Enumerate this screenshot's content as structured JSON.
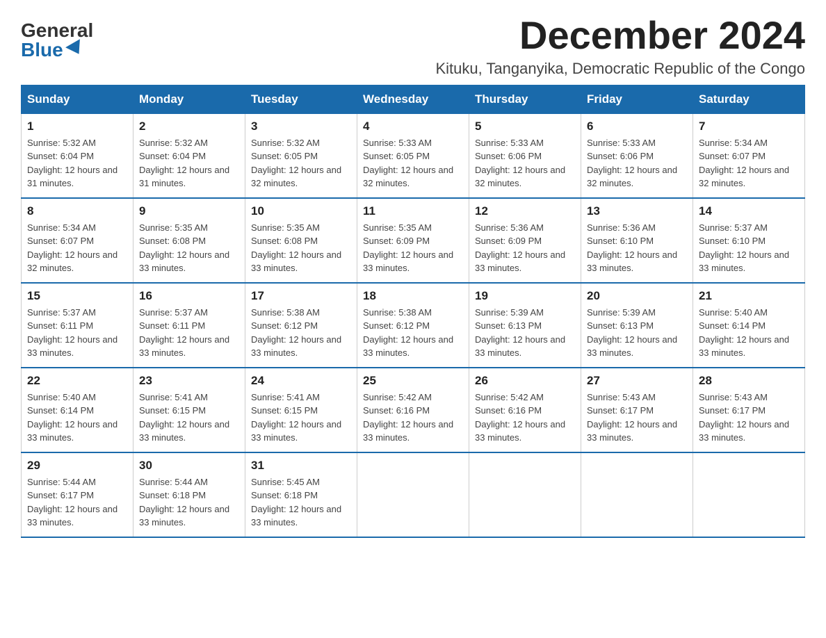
{
  "logo": {
    "general": "General",
    "blue": "Blue"
  },
  "header": {
    "month_year": "December 2024",
    "location": "Kituku, Tanganyika, Democratic Republic of the Congo"
  },
  "weekdays": [
    "Sunday",
    "Monday",
    "Tuesday",
    "Wednesday",
    "Thursday",
    "Friday",
    "Saturday"
  ],
  "weeks": [
    [
      {
        "day": "1",
        "sunrise": "5:32 AM",
        "sunset": "6:04 PM",
        "daylight": "12 hours and 31 minutes."
      },
      {
        "day": "2",
        "sunrise": "5:32 AM",
        "sunset": "6:04 PM",
        "daylight": "12 hours and 31 minutes."
      },
      {
        "day": "3",
        "sunrise": "5:32 AM",
        "sunset": "6:05 PM",
        "daylight": "12 hours and 32 minutes."
      },
      {
        "day": "4",
        "sunrise": "5:33 AM",
        "sunset": "6:05 PM",
        "daylight": "12 hours and 32 minutes."
      },
      {
        "day": "5",
        "sunrise": "5:33 AM",
        "sunset": "6:06 PM",
        "daylight": "12 hours and 32 minutes."
      },
      {
        "day": "6",
        "sunrise": "5:33 AM",
        "sunset": "6:06 PM",
        "daylight": "12 hours and 32 minutes."
      },
      {
        "day": "7",
        "sunrise": "5:34 AM",
        "sunset": "6:07 PM",
        "daylight": "12 hours and 32 minutes."
      }
    ],
    [
      {
        "day": "8",
        "sunrise": "5:34 AM",
        "sunset": "6:07 PM",
        "daylight": "12 hours and 32 minutes."
      },
      {
        "day": "9",
        "sunrise": "5:35 AM",
        "sunset": "6:08 PM",
        "daylight": "12 hours and 33 minutes."
      },
      {
        "day": "10",
        "sunrise": "5:35 AM",
        "sunset": "6:08 PM",
        "daylight": "12 hours and 33 minutes."
      },
      {
        "day": "11",
        "sunrise": "5:35 AM",
        "sunset": "6:09 PM",
        "daylight": "12 hours and 33 minutes."
      },
      {
        "day": "12",
        "sunrise": "5:36 AM",
        "sunset": "6:09 PM",
        "daylight": "12 hours and 33 minutes."
      },
      {
        "day": "13",
        "sunrise": "5:36 AM",
        "sunset": "6:10 PM",
        "daylight": "12 hours and 33 minutes."
      },
      {
        "day": "14",
        "sunrise": "5:37 AM",
        "sunset": "6:10 PM",
        "daylight": "12 hours and 33 minutes."
      }
    ],
    [
      {
        "day": "15",
        "sunrise": "5:37 AM",
        "sunset": "6:11 PM",
        "daylight": "12 hours and 33 minutes."
      },
      {
        "day": "16",
        "sunrise": "5:37 AM",
        "sunset": "6:11 PM",
        "daylight": "12 hours and 33 minutes."
      },
      {
        "day": "17",
        "sunrise": "5:38 AM",
        "sunset": "6:12 PM",
        "daylight": "12 hours and 33 minutes."
      },
      {
        "day": "18",
        "sunrise": "5:38 AM",
        "sunset": "6:12 PM",
        "daylight": "12 hours and 33 minutes."
      },
      {
        "day": "19",
        "sunrise": "5:39 AM",
        "sunset": "6:13 PM",
        "daylight": "12 hours and 33 minutes."
      },
      {
        "day": "20",
        "sunrise": "5:39 AM",
        "sunset": "6:13 PM",
        "daylight": "12 hours and 33 minutes."
      },
      {
        "day": "21",
        "sunrise": "5:40 AM",
        "sunset": "6:14 PM",
        "daylight": "12 hours and 33 minutes."
      }
    ],
    [
      {
        "day": "22",
        "sunrise": "5:40 AM",
        "sunset": "6:14 PM",
        "daylight": "12 hours and 33 minutes."
      },
      {
        "day": "23",
        "sunrise": "5:41 AM",
        "sunset": "6:15 PM",
        "daylight": "12 hours and 33 minutes."
      },
      {
        "day": "24",
        "sunrise": "5:41 AM",
        "sunset": "6:15 PM",
        "daylight": "12 hours and 33 minutes."
      },
      {
        "day": "25",
        "sunrise": "5:42 AM",
        "sunset": "6:16 PM",
        "daylight": "12 hours and 33 minutes."
      },
      {
        "day": "26",
        "sunrise": "5:42 AM",
        "sunset": "6:16 PM",
        "daylight": "12 hours and 33 minutes."
      },
      {
        "day": "27",
        "sunrise": "5:43 AM",
        "sunset": "6:17 PM",
        "daylight": "12 hours and 33 minutes."
      },
      {
        "day": "28",
        "sunrise": "5:43 AM",
        "sunset": "6:17 PM",
        "daylight": "12 hours and 33 minutes."
      }
    ],
    [
      {
        "day": "29",
        "sunrise": "5:44 AM",
        "sunset": "6:17 PM",
        "daylight": "12 hours and 33 minutes."
      },
      {
        "day": "30",
        "sunrise": "5:44 AM",
        "sunset": "6:18 PM",
        "daylight": "12 hours and 33 minutes."
      },
      {
        "day": "31",
        "sunrise": "5:45 AM",
        "sunset": "6:18 PM",
        "daylight": "12 hours and 33 minutes."
      },
      null,
      null,
      null,
      null
    ]
  ]
}
